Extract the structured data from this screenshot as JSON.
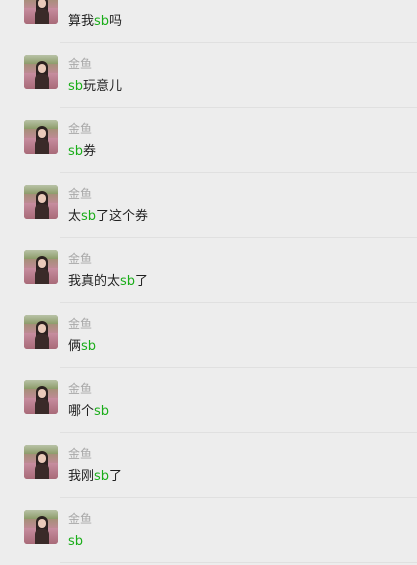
{
  "accent_color": "#1aad19",
  "avatar_icon": "user-photo-avatar",
  "messages": [
    {
      "name": "",
      "parts": [
        {
          "t": "算我",
          "hl": false
        },
        {
          "t": "sb",
          "hl": true
        },
        {
          "t": "吗",
          "hl": false
        }
      ]
    },
    {
      "name": "金鱼",
      "parts": [
        {
          "t": "sb",
          "hl": true
        },
        {
          "t": "玩意儿",
          "hl": false
        }
      ]
    },
    {
      "name": "金鱼",
      "parts": [
        {
          "t": "sb",
          "hl": true
        },
        {
          "t": "券",
          "hl": false
        }
      ]
    },
    {
      "name": "金鱼",
      "parts": [
        {
          "t": "太",
          "hl": false
        },
        {
          "t": "sb",
          "hl": true
        },
        {
          "t": "了这个券",
          "hl": false
        }
      ]
    },
    {
      "name": "金鱼",
      "parts": [
        {
          "t": "我真的太",
          "hl": false
        },
        {
          "t": "sb",
          "hl": true
        },
        {
          "t": "了",
          "hl": false
        }
      ]
    },
    {
      "name": "金鱼",
      "parts": [
        {
          "t": "俩",
          "hl": false
        },
        {
          "t": "sb",
          "hl": true
        }
      ]
    },
    {
      "name": "金鱼",
      "parts": [
        {
          "t": "哪个",
          "hl": false
        },
        {
          "t": "sb",
          "hl": true
        }
      ]
    },
    {
      "name": "金鱼",
      "parts": [
        {
          "t": "我刚",
          "hl": false
        },
        {
          "t": "sb",
          "hl": true
        },
        {
          "t": "了",
          "hl": false
        }
      ]
    },
    {
      "name": "金鱼",
      "parts": [
        {
          "t": "sb",
          "hl": true
        }
      ]
    }
  ]
}
